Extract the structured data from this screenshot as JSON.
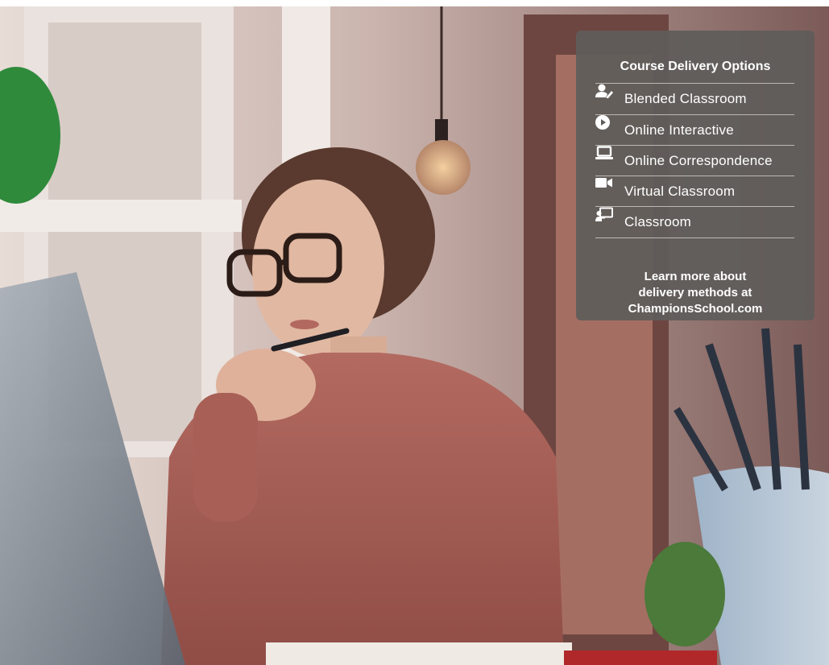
{
  "panel": {
    "title": "Course Delivery Options",
    "options": [
      {
        "label": "Blended Classroom",
        "icon": "user-edit-icon"
      },
      {
        "label": "Online Interactive",
        "icon": "play-circle-icon"
      },
      {
        "label": "Online Correspondence",
        "icon": "laptop-icon"
      },
      {
        "label": "Virtual Classroom",
        "icon": "video-camera-icon"
      },
      {
        "label": "Classroom",
        "icon": "chalkboard-teacher-icon"
      }
    ],
    "footer": {
      "line1": "Learn more about",
      "line2": "delivery methods at",
      "line3": "ChampionsSchool.com"
    }
  },
  "colors": {
    "panel_bg": "#5f5c5a",
    "panel_text": "#ffffff",
    "divider": "#bdb8b4"
  }
}
